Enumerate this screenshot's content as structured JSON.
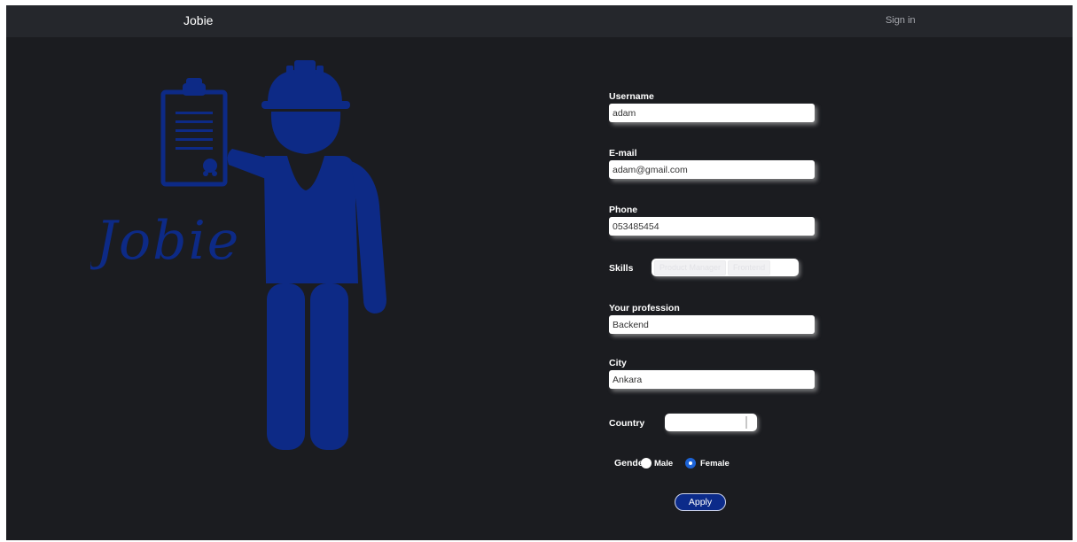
{
  "navbar": {
    "brand": "Jobie",
    "signin_label": "Sign in"
  },
  "hero": {
    "logo_text": "Jobie",
    "figure_color": "#0d2a86"
  },
  "form": {
    "username": {
      "label": "Username",
      "value": "adam"
    },
    "email": {
      "label": "E-mail",
      "value": "adam@gmail.com"
    },
    "phone": {
      "label": "Phone",
      "value": "053485454"
    },
    "skills": {
      "label": "Skills",
      "tags": [
        "Product Manager",
        "Frontend"
      ]
    },
    "profession": {
      "label": "Your profession",
      "value": "Backend"
    },
    "city": {
      "label": "City",
      "value": "Ankara"
    },
    "country": {
      "label": "Country",
      "value": ""
    },
    "gender": {
      "label": "Gender",
      "options": [
        {
          "label": "Male",
          "checked": false
        },
        {
          "label": "Female",
          "checked": true
        }
      ]
    },
    "apply_label": "Apply"
  },
  "colors": {
    "background": "#1b1c20",
    "navbar": "#25272c",
    "accent": "#0d2a86",
    "radio_checked": "#1d63d6"
  }
}
